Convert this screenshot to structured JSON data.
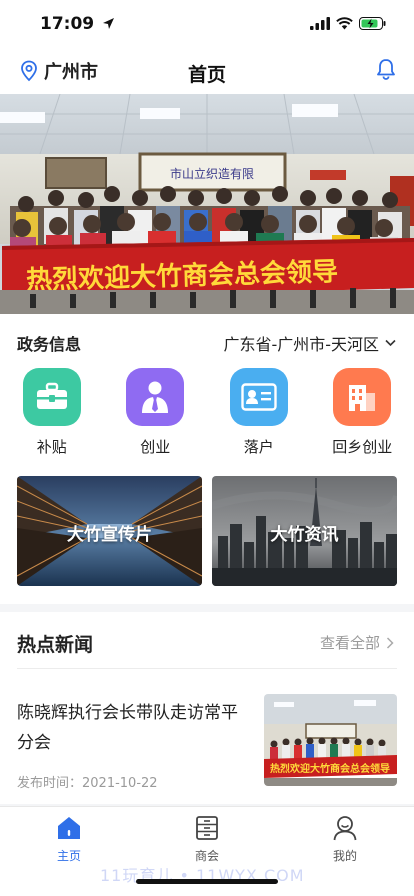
{
  "status_bar": {
    "time": "17:09"
  },
  "header": {
    "city": "广州市",
    "title": "首页"
  },
  "banner": {
    "slogan": "热烈欢迎大竹商会总会领导",
    "building_sign": "市山立织造有限"
  },
  "gov": {
    "section_title": "政务信息",
    "region": "广东省-广州市-天河区",
    "services": [
      {
        "label": "补贴",
        "icon": "briefcase-icon",
        "color": "#3dc9a2"
      },
      {
        "label": "创业",
        "icon": "person-tie-icon",
        "color": "#8f6bf2"
      },
      {
        "label": "落户",
        "icon": "id-card-icon",
        "color": "#4aaef0"
      },
      {
        "label": "回乡创业",
        "icon": "buildings-icon",
        "color": "#ff7a4f"
      }
    ],
    "cards": [
      {
        "label": "大竹宣传片"
      },
      {
        "label": "大竹资讯"
      }
    ]
  },
  "news": {
    "section_title": "热点新闻",
    "see_all": "查看全部",
    "items": [
      {
        "title": "陈晓辉执行会长带队走访常平分会",
        "date_label": "发布时间：",
        "date": "2021-10-22"
      }
    ]
  },
  "tabbar": {
    "tabs": [
      {
        "label": "主页",
        "active": true
      },
      {
        "label": "商会",
        "active": false
      },
      {
        "label": "我的",
        "active": false
      }
    ]
  },
  "watermark": "11玩育儿 • 11WYX.COM"
}
